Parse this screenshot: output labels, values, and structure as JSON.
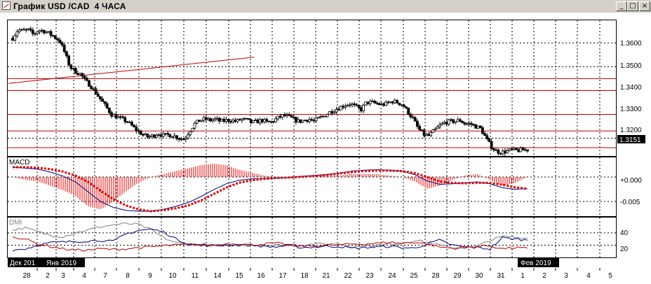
{
  "window": {
    "title": "График USD /CAD  4 ЧАСА",
    "minimize_label": "_",
    "maximize_label": "□",
    "close_label": "×"
  },
  "colors": {
    "background": "#ffffff",
    "grid": "#000000",
    "candle": "#000000",
    "level_lines": "#c00000",
    "macd_signal": "#e00000",
    "macd_main": "#000080",
    "macd_histogram": "#e00000",
    "dmi_adx": "#808080",
    "dmi_plus": "#000080",
    "dmi_minus": "#c00000"
  },
  "price_panel": {
    "axis_labels": [
      "1.3600",
      "1.3500",
      "1.3400",
      "1.3300",
      "1.3200"
    ],
    "current_price": "1.3151"
  },
  "macd_panel": {
    "label": "MACD",
    "axis_labels": [
      "+0.000",
      "-0.005"
    ]
  },
  "dmi_panel": {
    "label": "DMI",
    "axis_labels": [
      "40",
      "20"
    ]
  },
  "time_axis": {
    "day_labels": [
      "28",
      "2",
      "3",
      "4",
      "7",
      "8",
      "9",
      "10",
      "11",
      "14",
      "15",
      "16",
      "17",
      "18",
      "21",
      "22",
      "23",
      "24",
      "25",
      "28",
      "29",
      "30",
      "31",
      "1",
      "2",
      "3",
      "4",
      "5"
    ],
    "month_tags": [
      "Дек 201",
      "Янв 2019",
      "Фев 2019"
    ]
  },
  "chart_data": {
    "type": "candlestick",
    "title": "График USD /CAD  4 ЧАСА",
    "series": [
      {
        "name": "USD/CAD",
        "close_path": [
          1.362,
          1.3655,
          1.365,
          1.3655,
          1.3635,
          1.3655,
          1.365,
          1.364,
          1.3625,
          1.361,
          1.356,
          1.35,
          1.348,
          1.347,
          1.344,
          1.342,
          1.339,
          1.336,
          1.333,
          1.33,
          1.329,
          1.328,
          1.327,
          1.325,
          1.323,
          1.3215,
          1.3205,
          1.321,
          1.322,
          1.321,
          1.3215,
          1.321,
          1.32,
          1.3195,
          1.323,
          1.326,
          1.3275,
          1.328,
          1.3275,
          1.328,
          1.327,
          1.3275,
          1.3275,
          1.327,
          1.328,
          1.3275,
          1.3265,
          1.327,
          1.3275,
          1.3265,
          1.327,
          1.3285,
          1.3295,
          1.329,
          1.328,
          1.327,
          1.3275,
          1.328,
          1.327,
          1.3285,
          1.3295,
          1.331,
          1.332,
          1.333,
          1.334,
          1.3345,
          1.333,
          1.332,
          1.335,
          1.335,
          1.3345,
          1.334,
          1.3345,
          1.3355,
          1.335,
          1.334,
          1.331,
          1.328,
          1.324,
          1.3215,
          1.321,
          1.323,
          1.325,
          1.3265,
          1.327,
          1.327,
          1.3275,
          1.326,
          1.326,
          1.325,
          1.324,
          1.32,
          1.3165,
          1.3145,
          1.314,
          1.3145,
          1.315,
          1.3148,
          1.315,
          1.3151
        ]
      }
    ],
    "level_lines": [
      1.345,
      1.34,
      1.33,
      1.323,
      1.316
    ],
    "trendline": {
      "from": 1.343,
      "to": 1.354
    },
    "ylim": [
      1.3125,
      1.3695
    ],
    "macd": {
      "ylim": [
        -0.008,
        0.004
      ],
      "main_path": [
        0.002,
        0.0018,
        0.0016,
        0.001,
        0.0002,
        -0.001,
        -0.003,
        -0.005,
        -0.0062,
        -0.0068,
        -0.007,
        -0.007,
        -0.0066,
        -0.006,
        -0.0052,
        -0.004,
        -0.0026,
        -0.0014,
        -0.0007,
        -0.0004,
        -0.0003,
        -0.0002,
        -0.0001,
        0.0001,
        0.0003,
        0.0005,
        0.0008,
        0.0012,
        0.0014,
        0.0015,
        0.0014,
        0.0012,
        0.0005,
        -0.0008,
        -0.0015,
        -0.0014,
        -0.0012,
        -0.001,
        -0.0014,
        -0.0022,
        -0.0025,
        -0.0024
      ],
      "signal_path": [
        0.002,
        0.002,
        0.0019,
        0.0016,
        0.0011,
        0.0003,
        -0.001,
        -0.0028,
        -0.0045,
        -0.0058,
        -0.0066,
        -0.007,
        -0.0068,
        -0.0064,
        -0.0058,
        -0.0048,
        -0.0035,
        -0.0022,
        -0.0012,
        -0.0007,
        -0.0004,
        -0.0002,
        -0.0001,
        0.0,
        0.0002,
        0.0004,
        0.0007,
        0.001,
        0.0012,
        0.0013,
        0.0013,
        0.0012,
        0.0008,
        0.0,
        -0.0009,
        -0.0012,
        -0.0013,
        -0.0012,
        -0.0012,
        -0.0016,
        -0.0021,
        -0.0024
      ]
    },
    "dmi": {
      "ylim": [
        0,
        65
      ],
      "adx_path": [
        45,
        48,
        42,
        36,
        34,
        40,
        45,
        50,
        53,
        55,
        54,
        45,
        32,
        24,
        21,
        20,
        19,
        20,
        20,
        21,
        20,
        20,
        19,
        20,
        22,
        22,
        22,
        18,
        18,
        20,
        22,
        23,
        28,
        25,
        20,
        16,
        16,
        18,
        28,
        34,
        33,
        31
      ],
      "plus_path": [
        12,
        14,
        20,
        24,
        25,
        26,
        27,
        28,
        26,
        38,
        44,
        46,
        42,
        30,
        22,
        20,
        19,
        20,
        20,
        20,
        18,
        17,
        20,
        16,
        17,
        18,
        18,
        15,
        16,
        17,
        18,
        16,
        15,
        22,
        28,
        20,
        17,
        16,
        14,
        32,
        30,
        28
      ],
      "minus_path": [
        34,
        30,
        22,
        18,
        14,
        12,
        12,
        14,
        13,
        14,
        16,
        17,
        19,
        20,
        21,
        21,
        20,
        22,
        23,
        20,
        22,
        23,
        20,
        18,
        19,
        20,
        20,
        22,
        22,
        23,
        25,
        23,
        25,
        22,
        17,
        15,
        16,
        18,
        19,
        14,
        16,
        15
      ]
    }
  }
}
